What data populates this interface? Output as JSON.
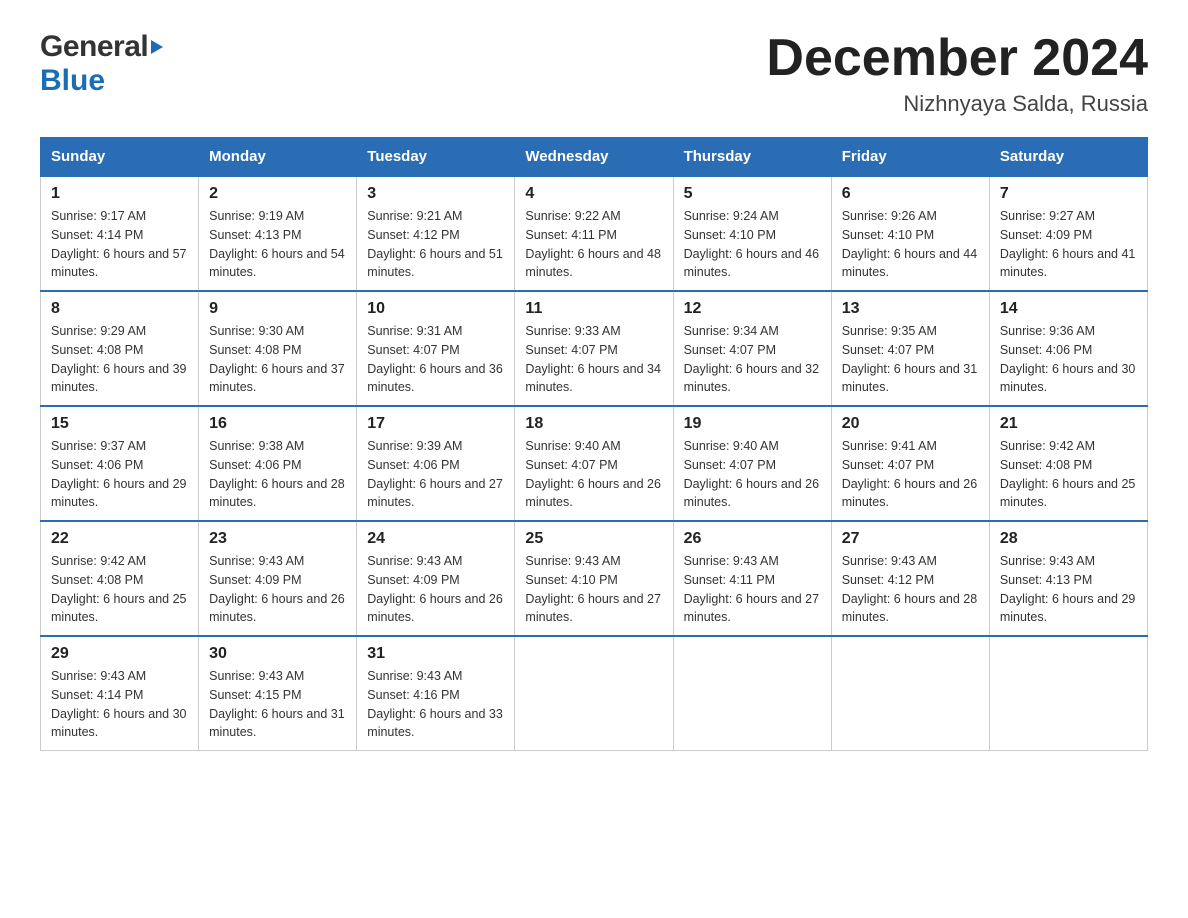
{
  "header": {
    "logo_general": "General",
    "logo_blue": "Blue",
    "month_year": "December 2024",
    "location": "Nizhnyaya Salda, Russia"
  },
  "days_of_week": [
    "Sunday",
    "Monday",
    "Tuesday",
    "Wednesday",
    "Thursday",
    "Friday",
    "Saturday"
  ],
  "weeks": [
    [
      {
        "day": "1",
        "sunrise": "9:17 AM",
        "sunset": "4:14 PM",
        "daylight": "6 hours and 57 minutes."
      },
      {
        "day": "2",
        "sunrise": "9:19 AM",
        "sunset": "4:13 PM",
        "daylight": "6 hours and 54 minutes."
      },
      {
        "day": "3",
        "sunrise": "9:21 AM",
        "sunset": "4:12 PM",
        "daylight": "6 hours and 51 minutes."
      },
      {
        "day": "4",
        "sunrise": "9:22 AM",
        "sunset": "4:11 PM",
        "daylight": "6 hours and 48 minutes."
      },
      {
        "day": "5",
        "sunrise": "9:24 AM",
        "sunset": "4:10 PM",
        "daylight": "6 hours and 46 minutes."
      },
      {
        "day": "6",
        "sunrise": "9:26 AM",
        "sunset": "4:10 PM",
        "daylight": "6 hours and 44 minutes."
      },
      {
        "day": "7",
        "sunrise": "9:27 AM",
        "sunset": "4:09 PM",
        "daylight": "6 hours and 41 minutes."
      }
    ],
    [
      {
        "day": "8",
        "sunrise": "9:29 AM",
        "sunset": "4:08 PM",
        "daylight": "6 hours and 39 minutes."
      },
      {
        "day": "9",
        "sunrise": "9:30 AM",
        "sunset": "4:08 PM",
        "daylight": "6 hours and 37 minutes."
      },
      {
        "day": "10",
        "sunrise": "9:31 AM",
        "sunset": "4:07 PM",
        "daylight": "6 hours and 36 minutes."
      },
      {
        "day": "11",
        "sunrise": "9:33 AM",
        "sunset": "4:07 PM",
        "daylight": "6 hours and 34 minutes."
      },
      {
        "day": "12",
        "sunrise": "9:34 AM",
        "sunset": "4:07 PM",
        "daylight": "6 hours and 32 minutes."
      },
      {
        "day": "13",
        "sunrise": "9:35 AM",
        "sunset": "4:07 PM",
        "daylight": "6 hours and 31 minutes."
      },
      {
        "day": "14",
        "sunrise": "9:36 AM",
        "sunset": "4:06 PM",
        "daylight": "6 hours and 30 minutes."
      }
    ],
    [
      {
        "day": "15",
        "sunrise": "9:37 AM",
        "sunset": "4:06 PM",
        "daylight": "6 hours and 29 minutes."
      },
      {
        "day": "16",
        "sunrise": "9:38 AM",
        "sunset": "4:06 PM",
        "daylight": "6 hours and 28 minutes."
      },
      {
        "day": "17",
        "sunrise": "9:39 AM",
        "sunset": "4:06 PM",
        "daylight": "6 hours and 27 minutes."
      },
      {
        "day": "18",
        "sunrise": "9:40 AM",
        "sunset": "4:07 PM",
        "daylight": "6 hours and 26 minutes."
      },
      {
        "day": "19",
        "sunrise": "9:40 AM",
        "sunset": "4:07 PM",
        "daylight": "6 hours and 26 minutes."
      },
      {
        "day": "20",
        "sunrise": "9:41 AM",
        "sunset": "4:07 PM",
        "daylight": "6 hours and 26 minutes."
      },
      {
        "day": "21",
        "sunrise": "9:42 AM",
        "sunset": "4:08 PM",
        "daylight": "6 hours and 25 minutes."
      }
    ],
    [
      {
        "day": "22",
        "sunrise": "9:42 AM",
        "sunset": "4:08 PM",
        "daylight": "6 hours and 25 minutes."
      },
      {
        "day": "23",
        "sunrise": "9:43 AM",
        "sunset": "4:09 PM",
        "daylight": "6 hours and 26 minutes."
      },
      {
        "day": "24",
        "sunrise": "9:43 AM",
        "sunset": "4:09 PM",
        "daylight": "6 hours and 26 minutes."
      },
      {
        "day": "25",
        "sunrise": "9:43 AM",
        "sunset": "4:10 PM",
        "daylight": "6 hours and 27 minutes."
      },
      {
        "day": "26",
        "sunrise": "9:43 AM",
        "sunset": "4:11 PM",
        "daylight": "6 hours and 27 minutes."
      },
      {
        "day": "27",
        "sunrise": "9:43 AM",
        "sunset": "4:12 PM",
        "daylight": "6 hours and 28 minutes."
      },
      {
        "day": "28",
        "sunrise": "9:43 AM",
        "sunset": "4:13 PM",
        "daylight": "6 hours and 29 minutes."
      }
    ],
    [
      {
        "day": "29",
        "sunrise": "9:43 AM",
        "sunset": "4:14 PM",
        "daylight": "6 hours and 30 minutes."
      },
      {
        "day": "30",
        "sunrise": "9:43 AM",
        "sunset": "4:15 PM",
        "daylight": "6 hours and 31 minutes."
      },
      {
        "day": "31",
        "sunrise": "9:43 AM",
        "sunset": "4:16 PM",
        "daylight": "6 hours and 33 minutes."
      },
      null,
      null,
      null,
      null
    ]
  ],
  "labels": {
    "sunrise": "Sunrise:",
    "sunset": "Sunset:",
    "daylight": "Daylight:"
  }
}
